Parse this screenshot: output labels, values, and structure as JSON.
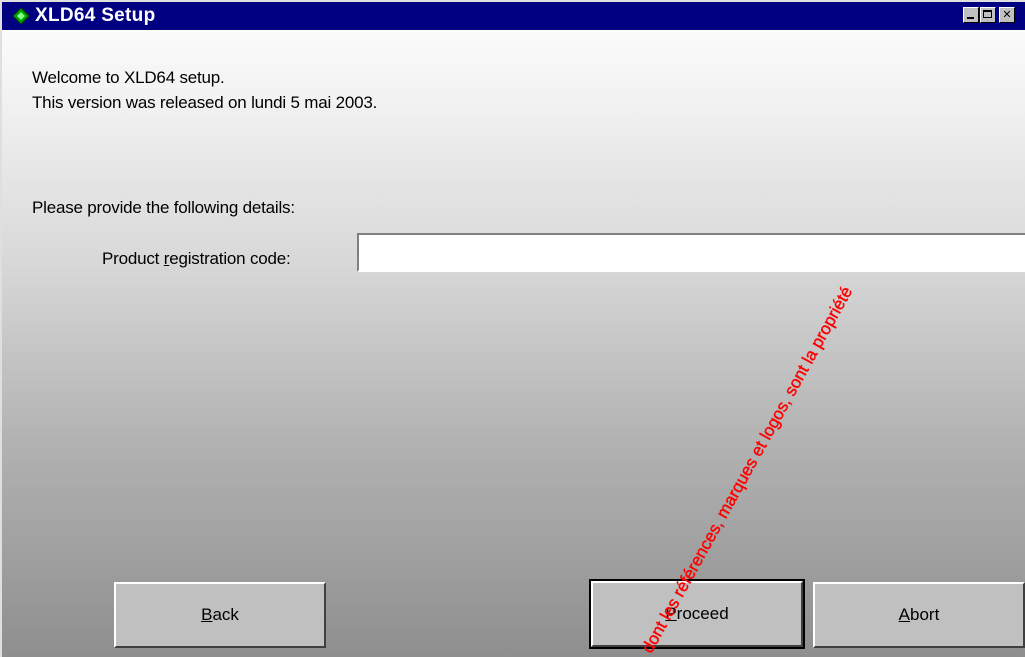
{
  "window": {
    "title": "XLD64 Setup",
    "title_bar_color": "#000080",
    "icon": "green-diamond-app-icon",
    "controls": [
      "minimize-icon",
      "maximize-icon",
      "close-icon"
    ]
  },
  "content": {
    "welcome_text": "Welcome to XLD64 setup.",
    "release_text": "This version was released on lundi 5 mai 2003.",
    "prompt_text": "Please provide the following details:",
    "fields": {
      "registration_code": {
        "label_pre": "Product ",
        "label_accel": "r",
        "label_post": "egistration code:",
        "value": ""
      }
    }
  },
  "buttons": {
    "back": {
      "accel": "B",
      "rest": "ack"
    },
    "proceed": {
      "accel": "P",
      "rest": "roceed"
    },
    "abort": {
      "accel": "A",
      "rest": "bort"
    }
  },
  "watermark": {
    "text": "dont les références, marques et logos, sont la propriété",
    "color": "#ff0000"
  }
}
